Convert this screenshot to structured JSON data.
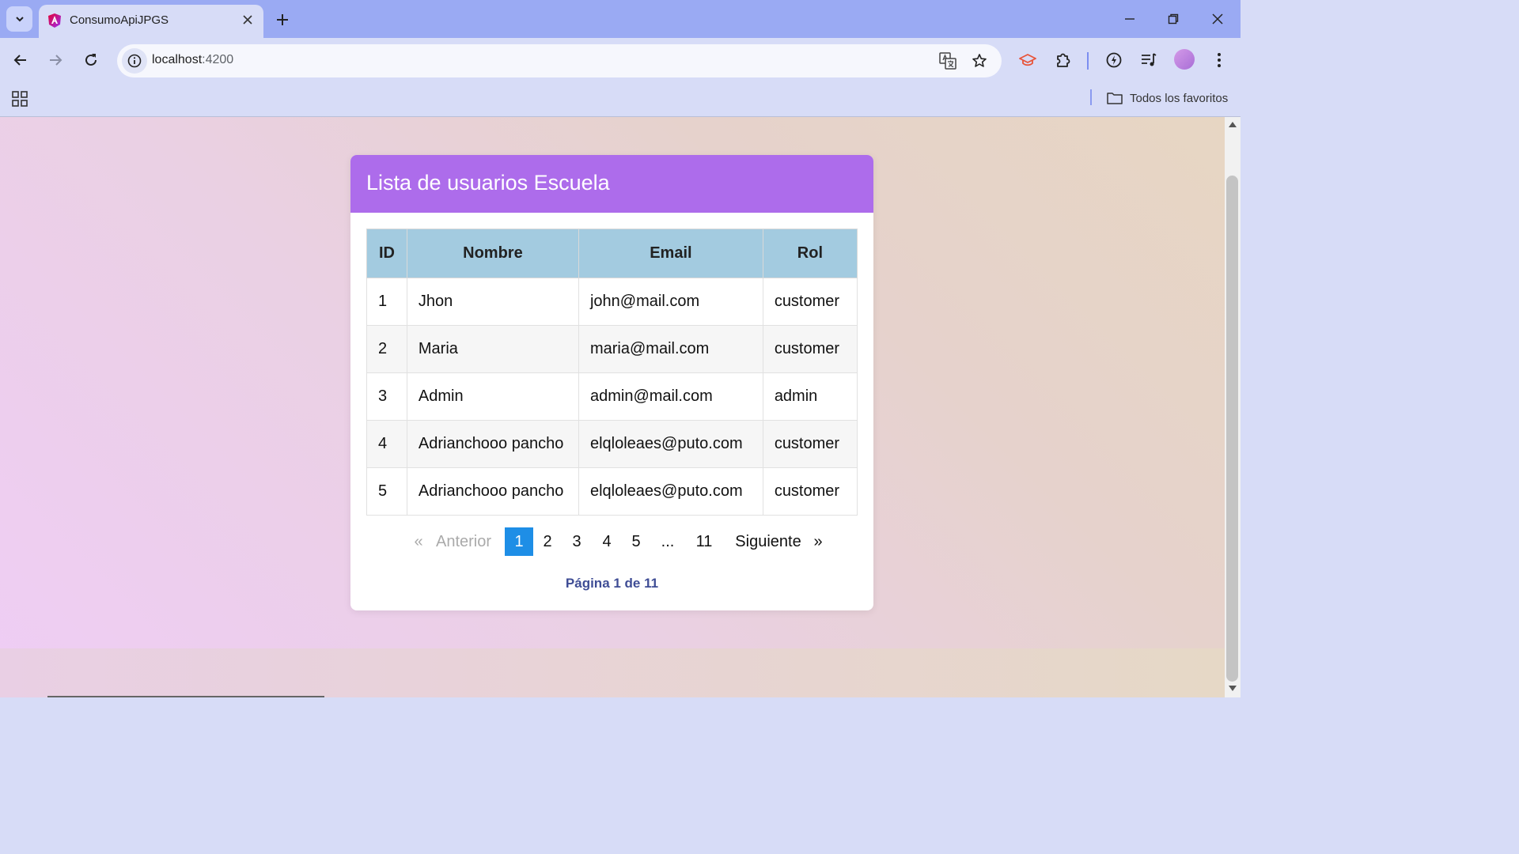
{
  "browser": {
    "tab": {
      "title": "ConsumoApiJPGS"
    },
    "address": {
      "host": "localhost",
      "port": ":4200"
    },
    "bookmarks": {
      "folder_label": "Todos los favoritos"
    }
  },
  "page": {
    "title": "Lista de usuarios Escuela",
    "table": {
      "headers": [
        "ID",
        "Nombre",
        "Email",
        "Rol"
      ],
      "rows": [
        [
          "1",
          "Jhon",
          "john@mail.com",
          "customer"
        ],
        [
          "2",
          "Maria",
          "maria@mail.com",
          "customer"
        ],
        [
          "3",
          "Admin",
          "admin@mail.com",
          "admin"
        ],
        [
          "4",
          "Adrianchooo pancho",
          "elqloleaes@puto.com",
          "customer"
        ],
        [
          "5",
          "Adrianchooo pancho",
          "elqloleaes@puto.com",
          "customer"
        ]
      ]
    },
    "pagination": {
      "first_symbol": "«",
      "prev": "Anterior",
      "pages": [
        "1",
        "2",
        "3",
        "4",
        "5",
        "...",
        "11"
      ],
      "current": "1",
      "next": "Siguiente",
      "last_symbol": "»",
      "info": "Página 1 de 11"
    }
  },
  "colors": {
    "header_bg": "#ad6ceb",
    "table_header_bg": "#a3cbe0",
    "active_page": "#1e8ee6",
    "page_info": "#3f4d95"
  }
}
